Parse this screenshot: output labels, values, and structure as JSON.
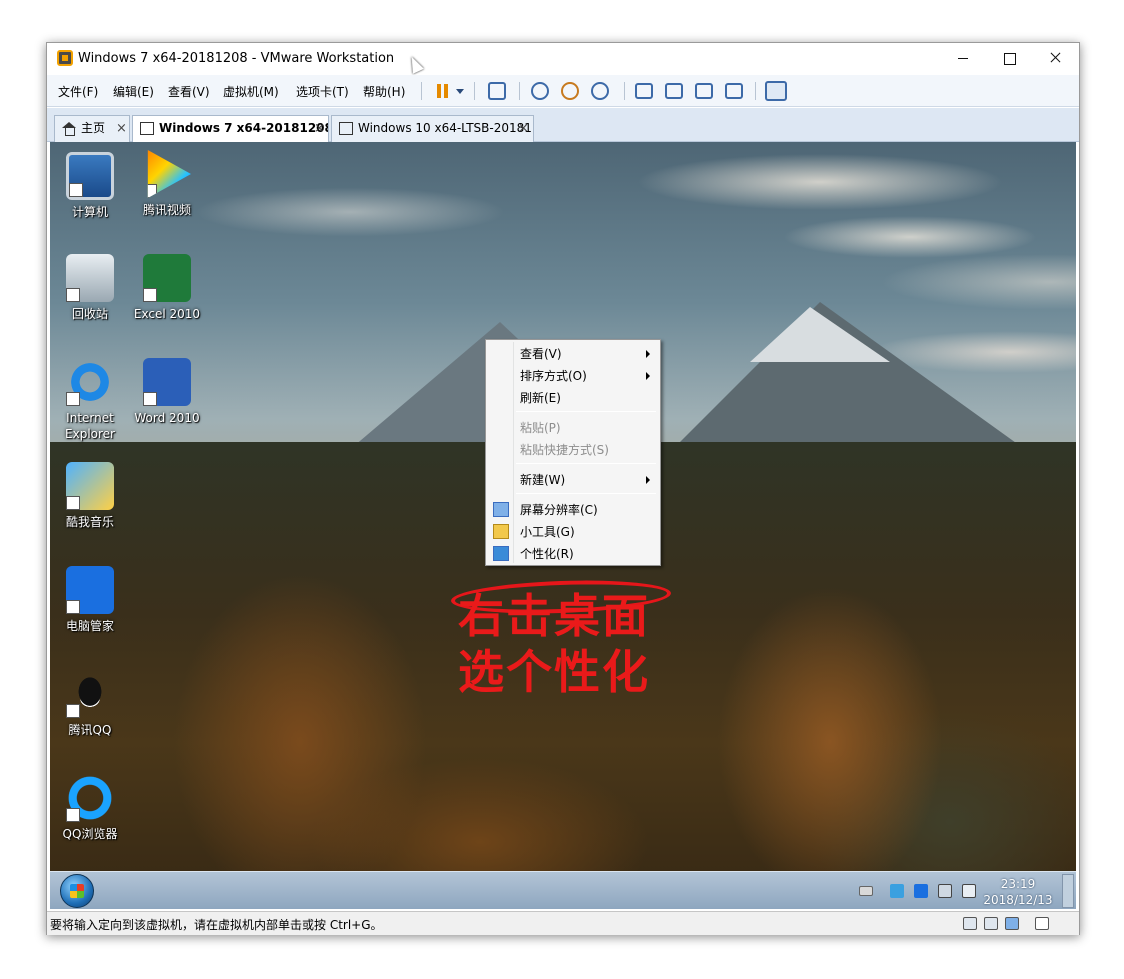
{
  "window": {
    "title": "Windows 7 x64-20181208 - VMware Workstation"
  },
  "menubar": [
    "文件(F)",
    "编辑(E)",
    "查看(V)",
    "虚拟机(M)",
    "选项卡(T)",
    "帮助(H)"
  ],
  "toolbar": {
    "icons": [
      "pause-icon",
      "dropdown-arrow-icon",
      "send-keys-icon",
      "snapshot-icon",
      "revert-snapshot-icon",
      "snapshot-manager-icon",
      "library-view-icon",
      "console-view-icon",
      "fullscreen-icon",
      "unity-icon",
      "thumbnail-icon"
    ]
  },
  "tabs": [
    {
      "label": "主页",
      "icon": "home-icon",
      "active": false
    },
    {
      "label": "Windows 7 x64-20181208",
      "icon": "vm-icon",
      "active": true
    },
    {
      "label": "Windows 10 x64-LTSB-20181...",
      "icon": "vm-icon",
      "active": false
    }
  ],
  "tab_close_glyph": "×",
  "desktop_icons": [
    {
      "label": "计算机",
      "icon": "computer-icon"
    },
    {
      "label": "腾讯视频",
      "icon": "tencent-video-icon"
    },
    {
      "label": "回收站",
      "icon": "recycle-bin-icon"
    },
    {
      "label": "Excel 2010",
      "icon": "excel-icon"
    },
    {
      "label": "Internet Explorer",
      "icon": "ie-icon"
    },
    {
      "label": "Word 2010",
      "icon": "word-icon"
    },
    {
      "label": "酷我音乐",
      "icon": "kuwo-music-icon"
    },
    {
      "label": "电脑管家",
      "icon": "pc-manager-icon"
    },
    {
      "label": "腾讯QQ",
      "icon": "qq-icon"
    },
    {
      "label": "QQ浏览器",
      "icon": "qq-browser-icon"
    }
  ],
  "context_menu": {
    "items": [
      {
        "label": "查看(V)",
        "submenu": true,
        "disabled": false
      },
      {
        "label": "排序方式(O)",
        "submenu": true,
        "disabled": false
      },
      {
        "label": "刷新(E)",
        "submenu": false,
        "disabled": false
      },
      {
        "label": "粘贴(P)",
        "submenu": false,
        "disabled": true
      },
      {
        "label": "粘贴快捷方式(S)",
        "submenu": false,
        "disabled": true
      },
      {
        "label": "新建(W)",
        "submenu": true,
        "disabled": false
      },
      {
        "label": "屏幕分辨率(C)",
        "submenu": false,
        "disabled": false,
        "icon": "screen-resolution-icon"
      },
      {
        "label": "小工具(G)",
        "submenu": false,
        "disabled": false,
        "icon": "gadgets-icon"
      },
      {
        "label": "个性化(R)",
        "submenu": false,
        "disabled": false,
        "icon": "personalize-icon"
      }
    ]
  },
  "annotation": {
    "line1": "右击桌面",
    "line2": "选个性化",
    "color": "#ea1a1a"
  },
  "taskbar": {
    "clock_time": "23:19",
    "clock_date": "2018/12/13",
    "tray_icons": [
      "keyboard-icon",
      "security-shield-icon",
      "pc-manager-tray-icon",
      "network-icon",
      "volume-muted-icon"
    ]
  },
  "statusbar": {
    "text": "要将输入定向到该虚拟机，请在虚拟机内部单击或按 Ctrl+G。",
    "icons": [
      "hard-disk-icon",
      "network-adapter-icon",
      "display-icon",
      "message-icon"
    ]
  }
}
